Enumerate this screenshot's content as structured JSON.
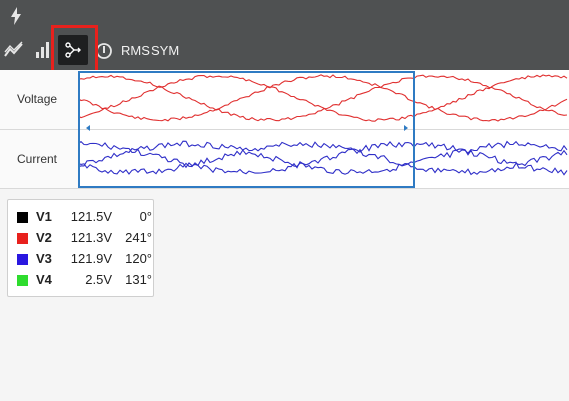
{
  "toolbar": {
    "rms_label": "RMS",
    "sym_label": "SYM"
  },
  "rows": {
    "voltage_label": "Voltage",
    "current_label": "Current"
  },
  "legend": [
    {
      "name": "V1",
      "value": "121.5V",
      "angle": "0°",
      "color": "#000000"
    },
    {
      "name": "V2",
      "value": "121.3V",
      "angle": "241°",
      "color": "#e8211d"
    },
    {
      "name": "V3",
      "value": "121.9V",
      "angle": "120°",
      "color": "#2a17e0"
    },
    {
      "name": "V4",
      "value": "2.5V",
      "angle": "131°",
      "color": "#2edc2e"
    }
  ],
  "colors": {
    "voltage_trace": "#e03030",
    "current_trace": "#2f2fc8",
    "selection_box": "#2f7bc3",
    "highlight_box": "#e8211d"
  }
}
